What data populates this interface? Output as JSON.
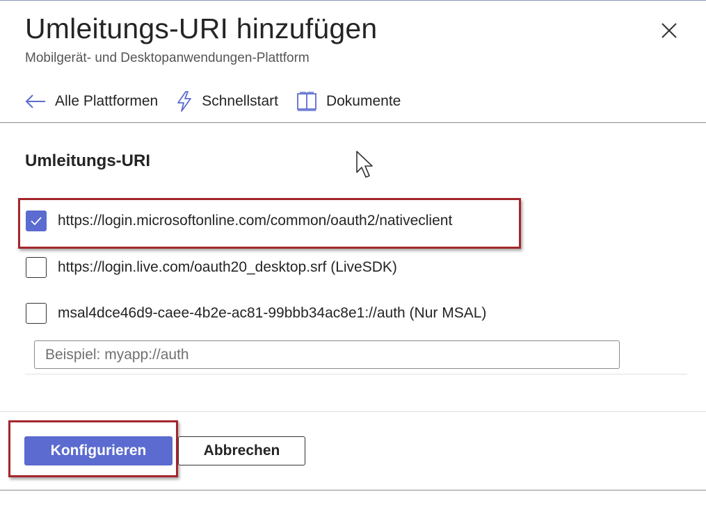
{
  "header": {
    "title": "Umleitungs-URI hinzufügen",
    "subtitle": "Mobilgerät- und Desktopanwendungen-Plattform"
  },
  "nav": {
    "items": [
      {
        "label": "Alle Plattformen",
        "icon": "arrow-left-icon"
      },
      {
        "label": "Schnellstart",
        "icon": "lightning-icon"
      },
      {
        "label": "Dokumente",
        "icon": "book-icon"
      }
    ]
  },
  "section": {
    "title": "Umleitungs-URI"
  },
  "redirect_options": [
    {
      "label": "https://login.microsoftonline.com/common/oauth2/nativeclient",
      "checked": true
    },
    {
      "label": "https://login.live.com/oauth20_desktop.srf (LiveSDK)",
      "checked": false
    },
    {
      "label": "msal4dce46d9-caee-4b2e-ac81-99bbb34ac8e1://auth (Nur MSAL)",
      "checked": false
    }
  ],
  "custom_uri": {
    "value": "",
    "placeholder": "Beispiel: myapp://auth"
  },
  "footer": {
    "primary_label": "Konfigurieren",
    "secondary_label": "Abbrechen"
  },
  "colors": {
    "accent": "#5b6bd0",
    "highlight_border": "#a4262c",
    "text": "#242424"
  }
}
